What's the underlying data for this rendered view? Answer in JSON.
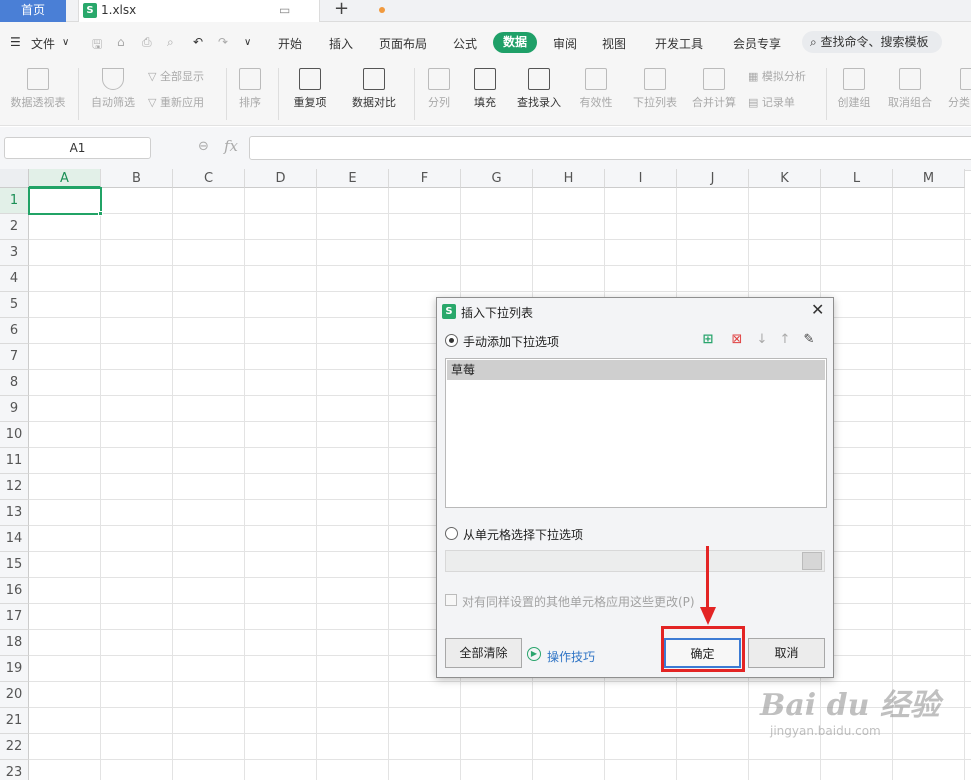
{
  "tabs": {
    "home": "首页",
    "file": "1.xlsx",
    "file_icon": "S"
  },
  "menu": {
    "file": "文件",
    "items": [
      "开始",
      "插入",
      "页面布局",
      "公式",
      "数据",
      "审阅",
      "视图",
      "开发工具",
      "会员专享"
    ],
    "search": "查找命令、搜索模板"
  },
  "ribbon": {
    "pivot": "数据透视表",
    "auto_filter": "自动筛选",
    "show_all": "全部显示",
    "reapply": "重新应用",
    "sort": "排序",
    "duplicates": "重复项",
    "compare": "数据对比",
    "split": "分列",
    "fill": "填充",
    "lookup": "查找录入",
    "validity": "有效性",
    "dropdown": "下拉列表",
    "merge_calc": "合并计算",
    "simulate": "模拟分析",
    "record": "记录单",
    "group": "创建组",
    "ungroup": "取消组合",
    "subtotal": "分类"
  },
  "formula_bar": {
    "name_box": "A1",
    "fx": "fx"
  },
  "columns": [
    "A",
    "B",
    "C",
    "D",
    "E",
    "F",
    "G",
    "H",
    "I",
    "J",
    "K",
    "L",
    "M"
  ],
  "rows": [
    "1",
    "2",
    "3",
    "4",
    "5",
    "6",
    "7",
    "8",
    "9",
    "10",
    "11",
    "12",
    "13",
    "14",
    "15",
    "16",
    "17",
    "18",
    "19",
    "20",
    "21",
    "22",
    "23"
  ],
  "dialog": {
    "title": "插入下拉列表",
    "icon": "S",
    "manual_option": "手动添加下拉选项",
    "items": [
      "草莓"
    ],
    "cell_option": "从单元格选择下拉选项",
    "apply_all": "对有同样设置的其他单元格应用这些更改(P)",
    "clear_all": "全部清除",
    "tips": "操作技巧",
    "ok": "确定",
    "cancel": "取消"
  },
  "watermark": {
    "main": "Bai du 经验",
    "sub": "jingyan.baidu.com"
  },
  "colors": {
    "accent": "#1fa068",
    "home_tab": "#4a7fd6",
    "highlight": "#e32424",
    "selection": "#21a366"
  }
}
